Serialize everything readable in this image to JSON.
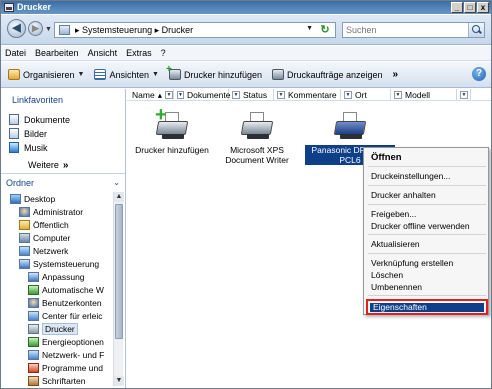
{
  "window": {
    "title": "Drucker",
    "buttons": {
      "minimize": "_",
      "maximize": "□",
      "close": "x"
    }
  },
  "address": {
    "crumb_sep": "▸",
    "path": "Systemsteuerung",
    "current": "Drucker",
    "search_placeholder": "Suchen"
  },
  "menu": [
    "Datei",
    "Bearbeiten",
    "Ansicht",
    "Extras",
    "?"
  ],
  "toolbar": {
    "organize": "Organisieren",
    "views": "Ansichten",
    "add_printer": "Drucker hinzufügen",
    "show_queue": "Druckaufträge anzeigen",
    "more": "»",
    "help": "?"
  },
  "favorites": {
    "header": "Linkfavoriten",
    "items": [
      "Dokumente",
      "Bilder",
      "Musik"
    ],
    "more": "Weitere",
    "more_chev": "»"
  },
  "folders": {
    "header": "Ordner",
    "chev": "⌄",
    "items": [
      "Desktop",
      "Administrator",
      "Öffentlich",
      "Computer",
      "Netzwerk",
      "Systemsteuerung",
      "Anpassung",
      "Automatische W",
      "Benutzerkonten",
      "Center für erleic",
      "Drucker",
      "Energieoptionen",
      "Netzwerk- und F",
      "Programme und",
      "Schriftarten"
    ]
  },
  "columns": [
    "Name",
    "Dokumente",
    "Status",
    "Kommentare",
    "Ort",
    "Modell"
  ],
  "printers": [
    {
      "label": "Drucker hinzufügen"
    },
    {
      "label": "Microsoft XPS Document Writer"
    },
    {
      "label": "Panasonic DP-C406 PCL6"
    }
  ],
  "context_menu": {
    "open": "Öffnen",
    "preferences": "Druckeinstellungen...",
    "pause": "Drucker anhalten",
    "share": "Freigeben...",
    "offline": "Drucker offline verwenden",
    "refresh": "Aktualisieren",
    "shortcut": "Verknüpfung erstellen",
    "delete": "Löschen",
    "rename": "Umbenennen",
    "properties": "Eigenschaften"
  },
  "colors": {
    "selection": "#0f3f88",
    "highlight_border": "#e02020",
    "title_bar": "#3a6ea5"
  }
}
